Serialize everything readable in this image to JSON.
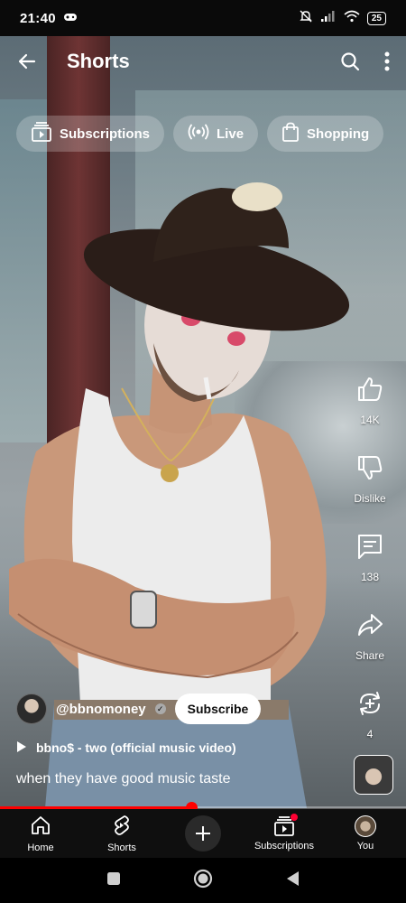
{
  "status_bar": {
    "time": "21:40",
    "battery": "25"
  },
  "header": {
    "title": "Shorts"
  },
  "chips": [
    {
      "label": "Subscriptions",
      "icon": "subscriptions-icon"
    },
    {
      "label": "Live",
      "icon": "live-icon"
    },
    {
      "label": "Shopping",
      "icon": "shopping-bag-icon"
    }
  ],
  "actions": {
    "like_count": "14K",
    "dislike_label": "Dislike",
    "comment_count": "138",
    "share_label": "Share",
    "remix_count": "4"
  },
  "video": {
    "channel": "@bbnomoney",
    "subscribe_label": "Subscribe",
    "music": "bbno$ - two (official music video)",
    "caption": "when they have good music taste",
    "progress": 0.47
  },
  "nav": {
    "home": "Home",
    "shorts": "Shorts",
    "subscriptions": "Subscriptions",
    "you": "You"
  },
  "colors": {
    "accent": "#ff0000",
    "nav_bg": "#0f0f0f"
  }
}
